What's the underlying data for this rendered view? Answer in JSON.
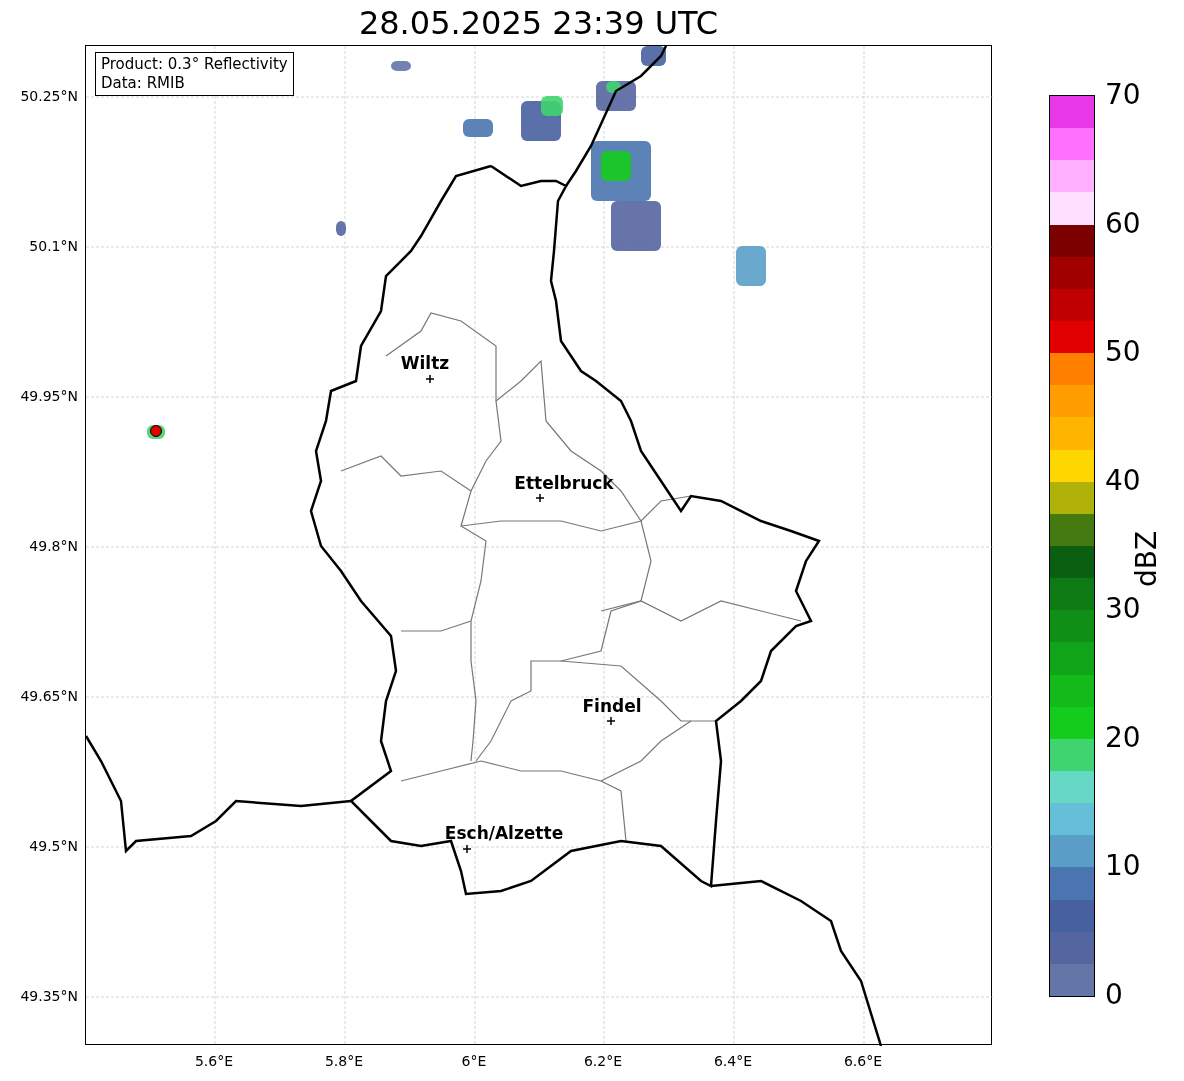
{
  "title": "28.05.2025 23:39 UTC",
  "legend": [
    "Product: 0.3° Reflectivity",
    "Data: RMIB"
  ],
  "cities": [
    {
      "name": "Wiltz"
    },
    {
      "name": "Ettelbruck"
    },
    {
      "name": "Findel"
    },
    {
      "name": "Esch/Alzette"
    }
  ],
  "x_ticks": [
    "5.6°E",
    "5.8°E",
    "6°E",
    "6.2°E",
    "6.4°E",
    "6.6°E"
  ],
  "y_ticks": [
    "50.25°N",
    "50.1°N",
    "49.95°N",
    "49.8°N",
    "49.65°N",
    "49.5°N",
    "49.35°N"
  ],
  "colorbar": {
    "label": "dBZ",
    "ticks": [
      "70",
      "60",
      "50",
      "40",
      "30",
      "20",
      "10",
      "0"
    ],
    "bands": [
      {
        "color": "#6475a8"
      },
      {
        "color": "#5565a0"
      },
      {
        "color": "#4760a0"
      },
      {
        "color": "#4a75b0"
      },
      {
        "color": "#5a9ec8"
      },
      {
        "color": "#65bfd8"
      },
      {
        "color": "#65d8c6"
      },
      {
        "color": "#3fd46f"
      },
      {
        "color": "#14cc1c"
      },
      {
        "color": "#12bb1a"
      },
      {
        "color": "#10a518"
      },
      {
        "color": "#0f8f16"
      },
      {
        "color": "#0e7a14"
      },
      {
        "color": "#0b5f10"
      },
      {
        "color": "#457a10"
      },
      {
        "color": "#b0b209"
      },
      {
        "color": "#ffd700"
      },
      {
        "color": "#ffb400"
      },
      {
        "color": "#ff9c00"
      },
      {
        "color": "#ff7f00"
      },
      {
        "color": "#e00000"
      },
      {
        "color": "#c00000"
      },
      {
        "color": "#a00000"
      },
      {
        "color": "#7b0000"
      },
      {
        "color": "#ffe0ff"
      },
      {
        "color": "#ffb0ff"
      },
      {
        "color": "#ff70ff"
      },
      {
        "color": "#e838e8"
      }
    ]
  }
}
